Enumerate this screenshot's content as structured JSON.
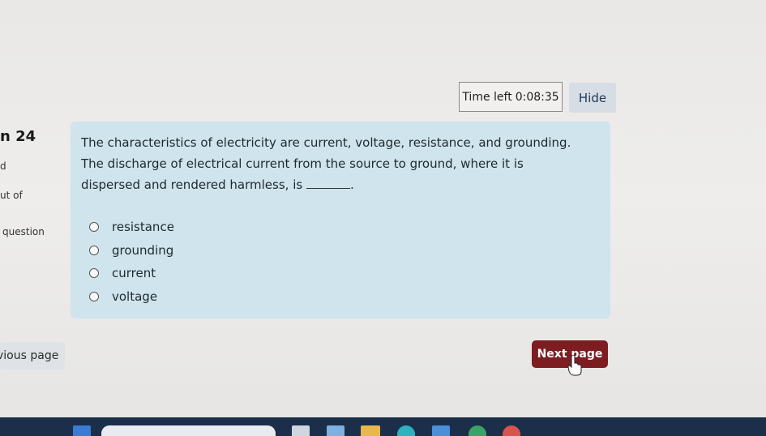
{
  "timer": {
    "label": "Time left",
    "value": "0:08:35"
  },
  "hide_button": "Hide",
  "question_info": {
    "number": "n 24",
    "status": "d",
    "points": "ut of",
    "flag": "question"
  },
  "question": {
    "text_before": "The characteristics of electricity are current, voltage, resistance, and grounding. The discharge of electrical current from the source to ground, where it is dispersed and rendered harmless, is",
    "text_after": ".",
    "options": [
      {
        "label": "resistance"
      },
      {
        "label": "grounding"
      },
      {
        "label": "current"
      },
      {
        "label": "voltage"
      }
    ]
  },
  "navigation": {
    "previous_label": "vious page",
    "next_label": "Next page"
  },
  "colors": {
    "card_bg": "#cfe4ec",
    "next_button": "#7d1d22",
    "hide_button": "#d7dde5",
    "taskbar": "#1b2f4a"
  }
}
